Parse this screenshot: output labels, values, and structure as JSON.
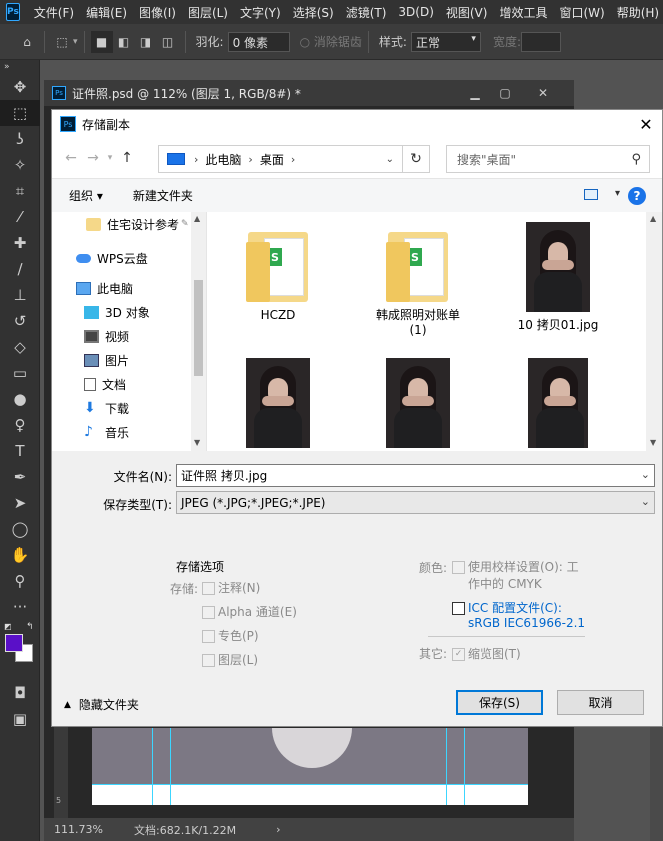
{
  "menubar": {
    "items": [
      "文件(F)",
      "编辑(E)",
      "图像(I)",
      "图层(L)",
      "文字(Y)",
      "选择(S)",
      "滤镜(T)",
      "3D(D)",
      "视图(V)",
      "增效工具",
      "窗口(W)",
      "帮助(H)"
    ]
  },
  "optionsbar": {
    "feather_label": "羽化:",
    "feather_value": "0 像素",
    "antialias_label": "消除锯齿",
    "style_label": "样式:",
    "style_value": "正常",
    "width_label": "宽度:"
  },
  "document": {
    "title": "证件照.psd @ 112% (图层 1, RGB/8#) *",
    "zoom": "111.73%",
    "doc_size": "文档:682.1K/1.22M",
    "ruler_mark": "5"
  },
  "dialog": {
    "title": "存储副本",
    "breadcrumbs": [
      "此电脑",
      "桌面"
    ],
    "search_placeholder": "搜索\"桌面\"",
    "organize_label": "组织 ▾",
    "new_folder_label": "新建文件夹",
    "sidebar": [
      {
        "label": "住宅设计参考",
        "icon": "folder-icon"
      },
      {
        "label": "WPS云盘",
        "icon": "cloud-icon"
      },
      {
        "label": "此电脑",
        "icon": "computer-icon"
      },
      {
        "label": "3D 对象",
        "icon": "cube-icon"
      },
      {
        "label": "视频",
        "icon": "video-icon"
      },
      {
        "label": "图片",
        "icon": "picture-icon"
      },
      {
        "label": "文档",
        "icon": "document-icon"
      },
      {
        "label": "下载",
        "icon": "download-icon"
      },
      {
        "label": "音乐",
        "icon": "music-icon"
      }
    ],
    "files": [
      {
        "label": "HCZD",
        "kind": "folder"
      },
      {
        "label": "韩成照明对账单 (1)",
        "kind": "folder"
      },
      {
        "label": "10 拷贝01.jpg",
        "kind": "photo"
      },
      {
        "label": "",
        "kind": "photo"
      },
      {
        "label": "",
        "kind": "photo"
      },
      {
        "label": "",
        "kind": "photo"
      }
    ],
    "filename_label": "文件名(N):",
    "filename_value": "证件照 拷贝.jpg",
    "filetype_label": "保存类型(T):",
    "filetype_value": "JPEG (*.JPG;*.JPEG;*.JPE)",
    "options": {
      "section_title": "存储选项",
      "save_label": "存储:",
      "annotations": "注释(N)",
      "alpha": "Alpha 通道(E)",
      "spot": "专色(P)",
      "layers": "图层(L)",
      "color_label": "颜色:",
      "proof": "使用校样设置(O): 工",
      "proof_sub": "作中的 CMYK",
      "icc": "ICC 配置文件(C):",
      "icc_sub": "sRGB IEC61966-2.1",
      "other_label": "其它:",
      "thumbnail": "缩览图(T)"
    },
    "hide_folders": "隐藏文件夹",
    "save_button": "保存(S)",
    "cancel_button": "取消"
  }
}
